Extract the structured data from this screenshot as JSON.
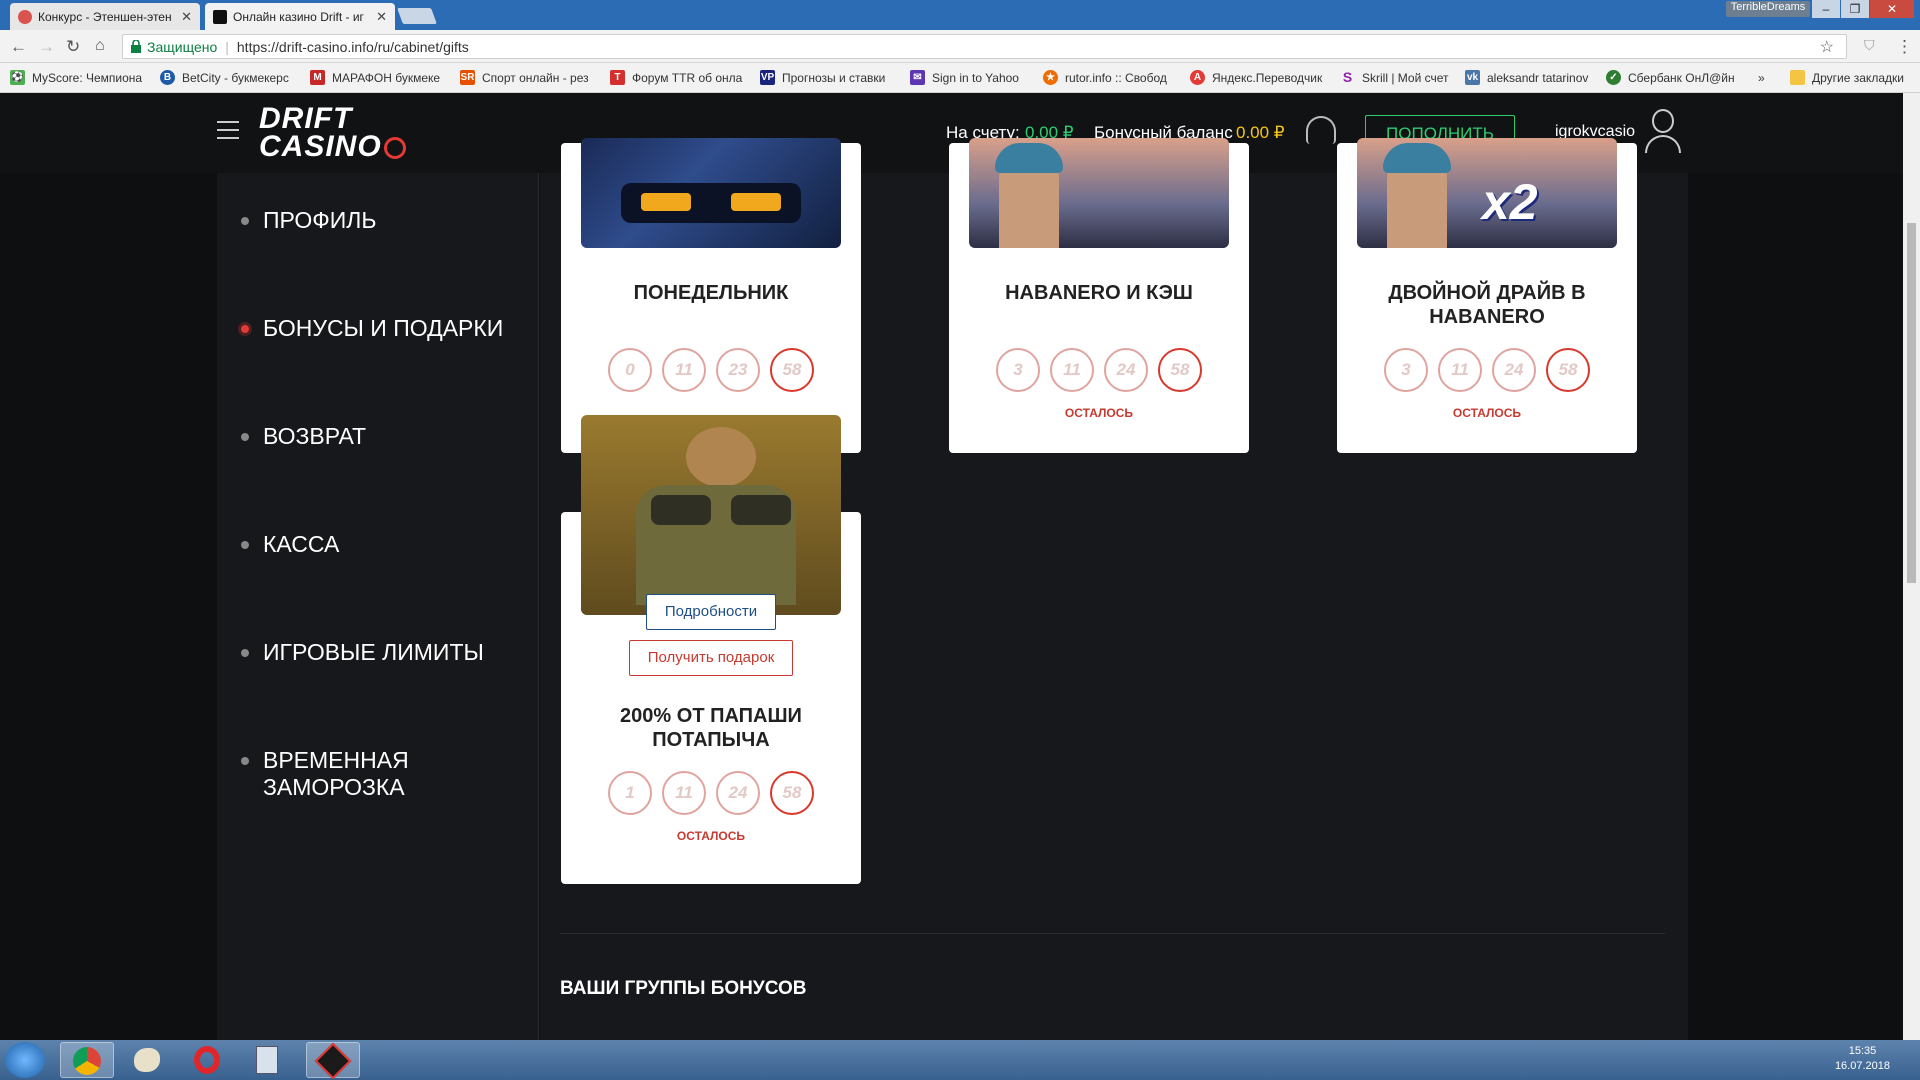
{
  "browser": {
    "tabs": [
      {
        "label": "Конкурс - Этеншен-этен",
        "active": false
      },
      {
        "label": "Онлайн казино Drift - иг",
        "active": true
      }
    ],
    "window_user": "TerribleDreams",
    "secure_label": "Защищено",
    "url": "https://drift-casino.info/ru/cabinet/gifts",
    "bookmarks": [
      "MyScore: Чемпиона",
      "BetCity - букмекерс",
      "МАРАФОН букмеке",
      "Спорт онлайн - рез",
      "Форум TTR об онла",
      "Прогнозы и ставки",
      "Sign in to Yahoo",
      "rutor.info :: Свобод",
      "Яндекс.Переводчик",
      "Skrill | Мой счет",
      "aleksandr tatarinov",
      "Сбербанк ОнЛ@йн"
    ],
    "bookmarks_more": "»",
    "other_bookmarks": "Другие закладки"
  },
  "header": {
    "logo_line1": "DRIFT",
    "logo_line2": "CASINO",
    "balance_label": "На счету:",
    "balance_value": "0.00 ₽",
    "bonus_label": "Бонусный баланс",
    "bonus_value": "0.00 ₽",
    "deposit_button": "ПОПОЛНИТЬ",
    "username": "igrokvcasio"
  },
  "sidebar": {
    "items": [
      {
        "label": "ПРОФИЛЬ",
        "active": false
      },
      {
        "label": "БОНУСЫ И ПОДАРКИ",
        "active": true
      },
      {
        "label": "ВОЗВРАТ",
        "active": false
      },
      {
        "label": "КАССА",
        "active": false
      },
      {
        "label": "ИГРОВЫЕ ЛИМИТЫ",
        "active": false
      },
      {
        "label": "ВРЕМЕННАЯ ЗАМОРОЗКА",
        "active": false
      }
    ]
  },
  "cards": [
    {
      "title": "ПОНЕДЕЛЬНИК",
      "counters": [
        "0",
        "11",
        "23",
        "58"
      ]
    },
    {
      "title": "HABANERO И КЭШ",
      "counters": [
        "3",
        "11",
        "24",
        "58"
      ],
      "remain": "ОСТАЛОСЬ"
    },
    {
      "title": "ДВОЙНОЙ ДРАЙВ В HABANERO",
      "counters": [
        "3",
        "11",
        "24",
        "58"
      ],
      "remain": "ОСТАЛОСЬ",
      "badge": "x2"
    },
    {
      "title": "200% ОТ ПАПАШИ ПОТАПЫЧА",
      "counters": [
        "1",
        "11",
        "24",
        "58"
      ],
      "remain": "ОСТАЛОСЬ",
      "details_button": "Подробности",
      "gift_button": "Получить подарок"
    }
  ],
  "groups_title": "ВАШИ ГРУППЫ БОНУСОВ",
  "taskbar": {
    "time": "15:35",
    "date": "16.07.2018"
  },
  "colors": {
    "accent_green": "#2ecc71",
    "accent_red": "#e53935",
    "bonus_gold": "#f5c518"
  }
}
